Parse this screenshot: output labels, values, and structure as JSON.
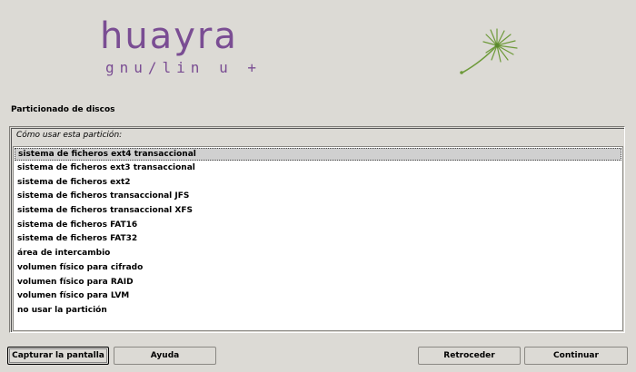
{
  "logo": {
    "main": "huayra",
    "sub": "gnu/lin u  +"
  },
  "section_title": "Particionado de discos",
  "prompt": "Cómo usar esta partición:",
  "options": [
    "sistema de ficheros ext4 transaccional",
    "sistema de ficheros ext3 transaccional",
    "sistema de ficheros ext2",
    "sistema de ficheros transaccional JFS",
    "sistema de ficheros transaccional XFS",
    "sistema de ficheros FAT16",
    "sistema de ficheros FAT32",
    "área de intercambio",
    "volumen físico para cifrado",
    "volumen físico para RAID",
    "volumen físico para LVM",
    "no usar la partición"
  ],
  "selected_index": 0,
  "buttons": {
    "screenshot": "Capturar la pantalla",
    "help": "Ayuda",
    "back": "Retroceder",
    "continue": "Continuar"
  },
  "colors": {
    "brand": "#7a4d93",
    "accent_green": "#6e9a3a",
    "background": "#dcdad5"
  },
  "icons": {
    "logo_mark": "dandelion-icon"
  }
}
